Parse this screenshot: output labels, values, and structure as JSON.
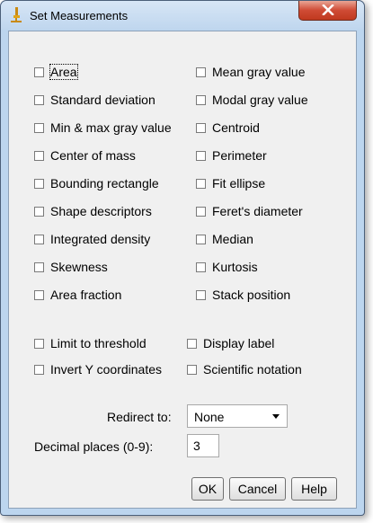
{
  "window": {
    "title": "Set Measurements",
    "close_glyph": "x"
  },
  "measurements_left": [
    "Area",
    "Standard deviation",
    "Min & max gray value",
    "Center of mass",
    "Bounding rectangle",
    "Shape descriptors",
    "Integrated density",
    "Skewness",
    "Area fraction"
  ],
  "measurements_right": [
    "Mean gray value",
    "Modal gray value",
    "Centroid",
    "Perimeter",
    "Fit ellipse",
    "Feret's diameter",
    "Median",
    "Kurtosis",
    "Stack position"
  ],
  "options": {
    "limit_to_threshold": "Limit to threshold",
    "display_label": "Display label",
    "invert_y": "Invert Y coordinates",
    "scientific_notation": "Scientific notation"
  },
  "redirect": {
    "label": "Redirect to:",
    "value": "None"
  },
  "decimal": {
    "label": "Decimal places (0-9):",
    "value": "3"
  },
  "buttons": {
    "ok": "OK",
    "cancel": "Cancel",
    "help": "Help"
  }
}
